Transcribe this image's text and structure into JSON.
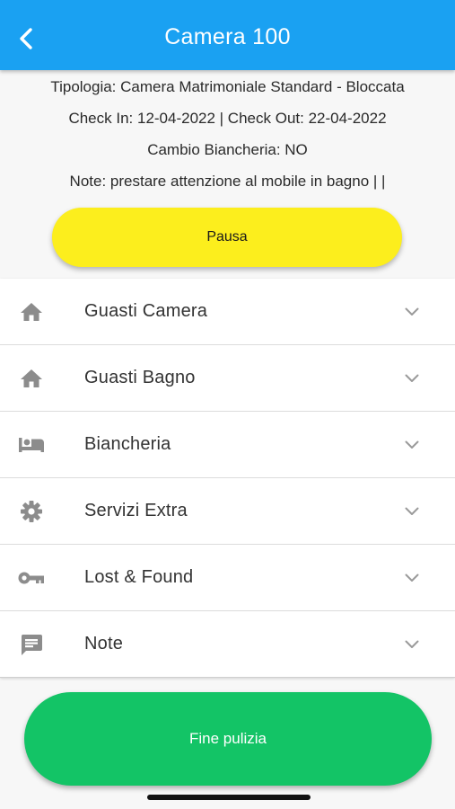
{
  "header": {
    "title": "Camera 100",
    "back_icon": "chevron-left-icon",
    "background": "#1aa1f2"
  },
  "room_info": {
    "tipologia": "Tipologia: Camera Matrimoniale Standard - Bloccata",
    "dates": "Check In: 12-04-2022 | Check Out: 22-04-2022",
    "cambio_biancheria": "Cambio Biancheria: NO",
    "note": "Note: prestare attenzione al mobile in bagno |  |"
  },
  "pause_button": {
    "label": "Pausa",
    "color": "#fcee1d"
  },
  "sections": [
    {
      "label": "Guasti Camera",
      "icon": "home-icon"
    },
    {
      "label": "Guasti Bagno",
      "icon": "home-icon"
    },
    {
      "label": "Biancheria",
      "icon": "bed-icon"
    },
    {
      "label": "Servizi Extra",
      "icon": "gear-icon"
    },
    {
      "label": "Lost & Found",
      "icon": "key-icon"
    },
    {
      "label": "Note",
      "icon": "comment-icon"
    }
  ],
  "finish_button": {
    "label": "Fine pulizia",
    "color": "#13c466"
  }
}
